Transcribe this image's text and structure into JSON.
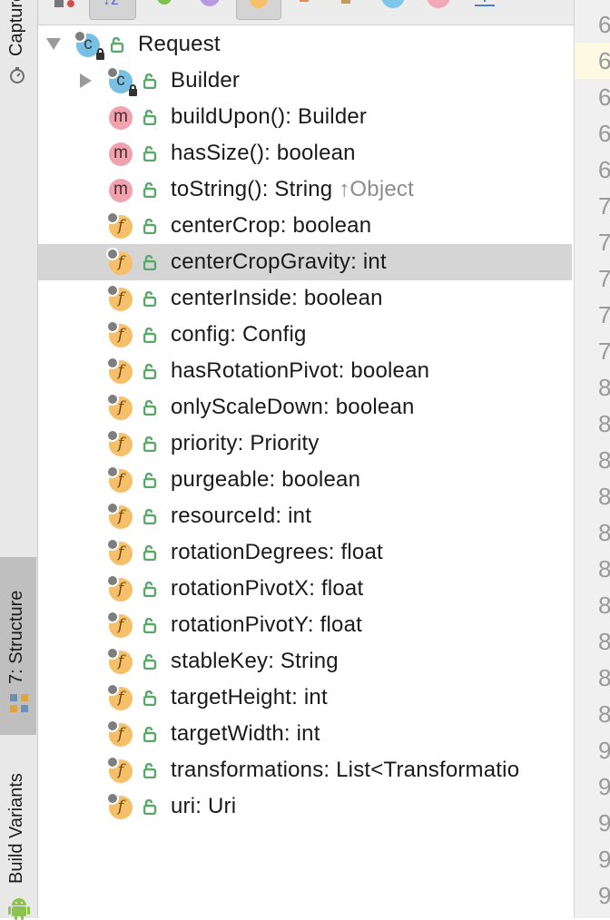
{
  "left_strip": {
    "captures_label": "Captures",
    "structure_label": "7: Structure",
    "build_variants_label": "Build Variants"
  },
  "toolbar": {
    "icons": [
      "sort-visibility-icon",
      "sort-alpha-icon",
      "show-inherited-icon",
      "show-properties-icon",
      "show-fields-icon",
      "expand-icon",
      "autoscroll-icon",
      "collapse-icon",
      "close-icon",
      "download-icon"
    ]
  },
  "tree": {
    "root": {
      "label": "Request",
      "kind": "c",
      "expanded": true
    },
    "items": [
      {
        "label": "Builder",
        "kind": "c",
        "expandable": true
      },
      {
        "label": "buildUpon(): Builder",
        "kind": "m"
      },
      {
        "label": "hasSize(): boolean",
        "kind": "m"
      },
      {
        "label": "toString(): String",
        "kind": "m",
        "inherited": "↑Object"
      },
      {
        "label": "centerCrop: boolean",
        "kind": "f"
      },
      {
        "label": "centerCropGravity: int",
        "kind": "f",
        "selected": true
      },
      {
        "label": "centerInside: boolean",
        "kind": "f"
      },
      {
        "label": "config: Config",
        "kind": "f"
      },
      {
        "label": "hasRotationPivot: boolean",
        "kind": "f"
      },
      {
        "label": "onlyScaleDown: boolean",
        "kind": "f"
      },
      {
        "label": "priority: Priority",
        "kind": "f"
      },
      {
        "label": "purgeable: boolean",
        "kind": "f"
      },
      {
        "label": "resourceId: int",
        "kind": "f"
      },
      {
        "label": "rotationDegrees: float",
        "kind": "f"
      },
      {
        "label": "rotationPivotX: float",
        "kind": "f"
      },
      {
        "label": "rotationPivotY: float",
        "kind": "f"
      },
      {
        "label": "stableKey: String",
        "kind": "f"
      },
      {
        "label": "targetHeight: int",
        "kind": "f"
      },
      {
        "label": "targetWidth: int",
        "kind": "f"
      },
      {
        "label": "transformations: List<Transformatio",
        "kind": "f"
      },
      {
        "label": "uri: Uri",
        "kind": "f"
      }
    ]
  },
  "gutter": {
    "lines": [
      "6",
      "6",
      "6",
      "6",
      "6",
      "7",
      "7",
      "7",
      "7",
      "7",
      "8",
      "8",
      "8",
      "8",
      "8",
      "8",
      "8",
      "8",
      "8",
      "8",
      "9",
      "9",
      "9",
      "9",
      "9"
    ]
  },
  "colors": {
    "class_icon": "#77bfe3",
    "method_icon": "#f0a2ad",
    "field_icon": "#f6c06a",
    "public_lock": "#59a869",
    "selection": "#d5d5d5"
  }
}
